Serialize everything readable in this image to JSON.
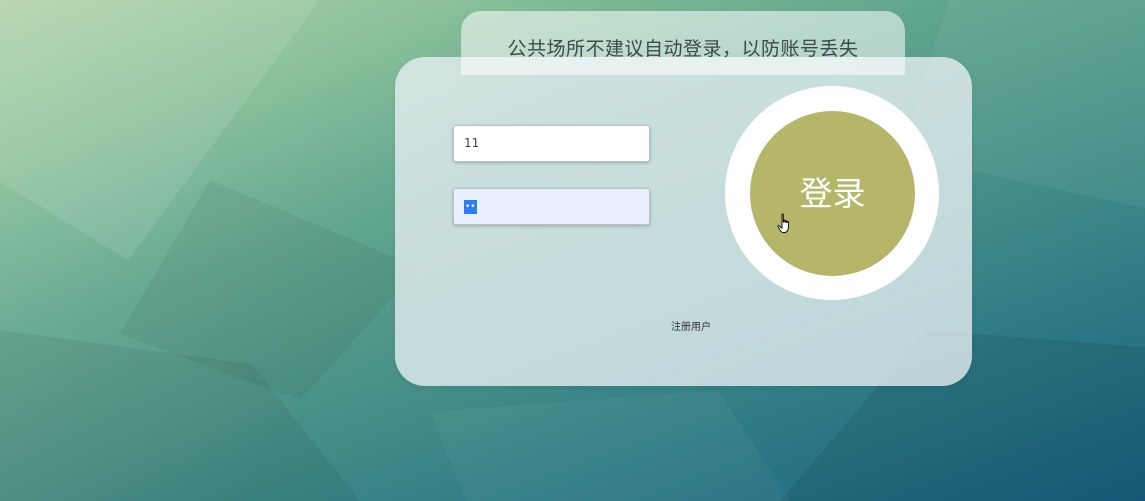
{
  "notice": {
    "text": "公共场所不建议自动登录，以防账号丢失"
  },
  "login_form": {
    "username_value": "11",
    "password_mask": "••",
    "login_button_label": "登录",
    "register_link_label": "注册用户"
  },
  "colors": {
    "login_button": "#b6b66a",
    "login_ring": "#ffffff",
    "password_autofill_bg": "#e8f0fe"
  },
  "icons": {
    "cursor": "hand-pointer-icon"
  }
}
